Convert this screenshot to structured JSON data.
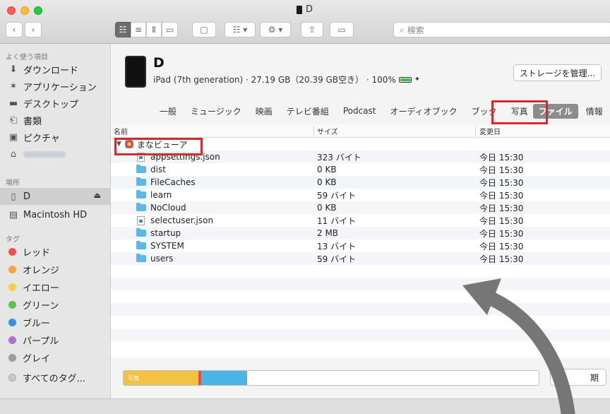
{
  "window": {
    "title": "D"
  },
  "toolbar": {
    "back_icon": "chevron-left-icon",
    "forward_icon": "chevron-right-icon",
    "search_placeholder": "検索"
  },
  "sidebar": {
    "favorites_header": "よく使う項目",
    "favorites": [
      {
        "label": "ダウンロード",
        "icon": "download-icon"
      },
      {
        "label": "アプリケーション",
        "icon": "applications-icon"
      },
      {
        "label": "デスクトップ",
        "icon": "desktop-icon"
      },
      {
        "label": "書類",
        "icon": "documents-icon"
      },
      {
        "label": "ピクチャ",
        "icon": "pictures-icon"
      }
    ],
    "locations_header": "場所",
    "locations": [
      {
        "label": "D",
        "icon": "ipad-icon"
      },
      {
        "label": "Macintosh HD",
        "icon": "hard-drive-icon"
      }
    ],
    "tags_header": "タグ",
    "tags": [
      {
        "label": "レッド",
        "color": "#f2504b"
      },
      {
        "label": "オレンジ",
        "color": "#f6a43d"
      },
      {
        "label": "イエロー",
        "color": "#f5cf46"
      },
      {
        "label": "グリーン",
        "color": "#5ac34f"
      },
      {
        "label": "ブルー",
        "color": "#3c8fe0"
      },
      {
        "label": "パープル",
        "color": "#b06fce"
      },
      {
        "label": "グレイ",
        "color": "#9c9ca0"
      },
      {
        "label": "すべてのタグ...",
        "color": "#c9c9cc"
      }
    ]
  },
  "device": {
    "name": "D",
    "info": "iPad (7th generation) · 27.19 GB（20.39 GB空き） · 100%",
    "manage_label": "ストレージを管理..."
  },
  "tabs": [
    "一般",
    "ミュージック",
    "映画",
    "テレビ番組",
    "Podcast",
    "オーディオブック",
    "ブック",
    "写真",
    "ファイル",
    "情報"
  ],
  "selected_tab": "ファイル",
  "table": {
    "headers": {
      "name": "名前",
      "size": "サイズ",
      "date": "変更日"
    },
    "app": "まなビューア",
    "rows": [
      {
        "name": "appsettings.json",
        "size": "323 バイト",
        "date": "今日 15:30",
        "kind": "document"
      },
      {
        "name": "dist",
        "size": "0 KB",
        "date": "今日 15:30",
        "kind": "folder"
      },
      {
        "name": "FileCaches",
        "size": "0 KB",
        "date": "今日 15:30",
        "kind": "folder"
      },
      {
        "name": "learn",
        "size": "59 バイト",
        "date": "今日 15:30",
        "kind": "folder"
      },
      {
        "name": "NoCloud",
        "size": "0 KB",
        "date": "今日 15:30",
        "kind": "folder"
      },
      {
        "name": "selectuser.json",
        "size": "11 バイト",
        "date": "今日 15:30",
        "kind": "document"
      },
      {
        "name": "startup",
        "size": "2 MB",
        "date": "今日 15:30",
        "kind": "folder"
      },
      {
        "name": "SYSTEM",
        "size": "13 バイト",
        "date": "今日 15:30",
        "kind": "folder"
      },
      {
        "name": "users",
        "size": "59 バイト",
        "date": "今日 15:30",
        "kind": "folder"
      }
    ]
  },
  "storage": {
    "photos_label": "写真",
    "segments": [
      {
        "name": "photos",
        "fraction": 0.18,
        "color": "#f3c23f"
      },
      {
        "name": "other-red",
        "fraction": 0.006,
        "color": "#e64b53"
      },
      {
        "name": "other-blue",
        "fraction": 0.11,
        "color": "#49b5e9"
      }
    ]
  },
  "sync_label": "期"
}
